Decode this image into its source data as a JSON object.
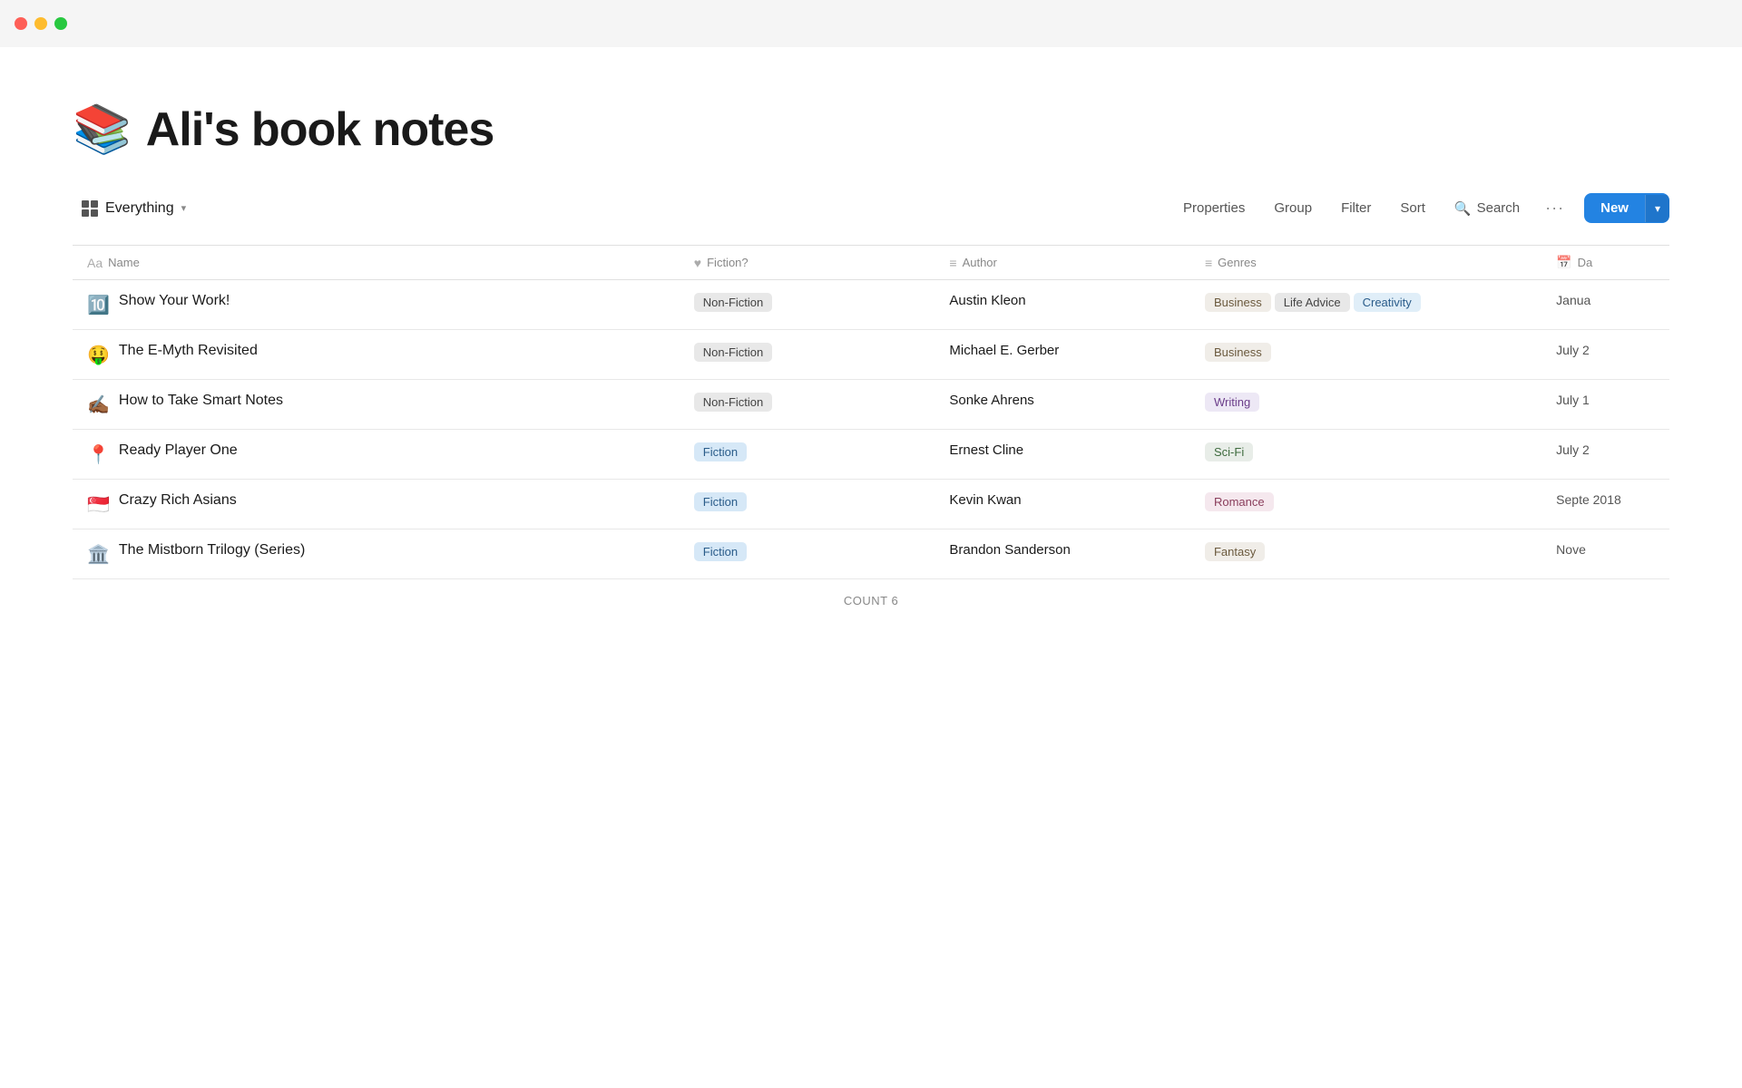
{
  "titlebar": {
    "traffic_lights": [
      "red",
      "yellow",
      "green"
    ]
  },
  "page": {
    "emoji": "📚",
    "title": "Ali's book notes"
  },
  "toolbar": {
    "view_label": "Everything",
    "properties_label": "Properties",
    "group_label": "Group",
    "filter_label": "Filter",
    "sort_label": "Sort",
    "search_label": "Search",
    "more_label": "···",
    "new_label": "New"
  },
  "table": {
    "headers": [
      {
        "id": "name",
        "label": "Name",
        "icon": "Aa"
      },
      {
        "id": "fiction",
        "label": "Fiction?",
        "icon": "♥"
      },
      {
        "id": "author",
        "label": "Author",
        "icon": "≡"
      },
      {
        "id": "genres",
        "label": "Genres",
        "icon": "≡"
      },
      {
        "id": "date",
        "label": "Da",
        "icon": "📅"
      }
    ],
    "rows": [
      {
        "emoji": "🔟",
        "title": "Show Your Work!",
        "fiction_badge": "Non-Fiction",
        "fiction_type": "nonfiction",
        "author": "Austin Kleon",
        "genres": [
          {
            "label": "Business",
            "type": "business"
          },
          {
            "label": "Life Advice",
            "type": "lifeadvice"
          },
          {
            "label": "Creativity",
            "type": "creativity"
          }
        ],
        "date": "Janua"
      },
      {
        "emoji": "🤑",
        "title": "The E-Myth Revisited",
        "fiction_badge": "Non-Fiction",
        "fiction_type": "nonfiction",
        "author": "Michael E. Gerber",
        "genres": [
          {
            "label": "Business",
            "type": "business"
          }
        ],
        "date": "July 2"
      },
      {
        "emoji": "✍🏾",
        "title": "How to Take Smart Notes",
        "fiction_badge": "Non-Fiction",
        "fiction_type": "nonfiction",
        "author": "Sonke Ahrens",
        "genres": [
          {
            "label": "Writing",
            "type": "writing"
          }
        ],
        "date": "July 1"
      },
      {
        "emoji": "📍",
        "title": "Ready Player One",
        "fiction_badge": "Fiction",
        "fiction_type": "fiction",
        "author": "Ernest Cline",
        "genres": [
          {
            "label": "Sci-Fi",
            "type": "scifi"
          }
        ],
        "date": "July 2"
      },
      {
        "emoji": "🇸🇬",
        "title": "Crazy Rich Asians",
        "fiction_badge": "Fiction",
        "fiction_type": "fiction",
        "author": "Kevin Kwan",
        "genres": [
          {
            "label": "Romance",
            "type": "romance"
          }
        ],
        "date": "Septe 2018"
      },
      {
        "emoji": "🏛️",
        "title": "The Mistborn Trilogy (Series)",
        "fiction_badge": "Fiction",
        "fiction_type": "fiction",
        "author": "Brandon Sanderson",
        "genres": [
          {
            "label": "Fantasy",
            "type": "fantasy"
          }
        ],
        "date": "Nove"
      }
    ]
  },
  "count": {
    "label": "COUNT",
    "value": "6"
  }
}
